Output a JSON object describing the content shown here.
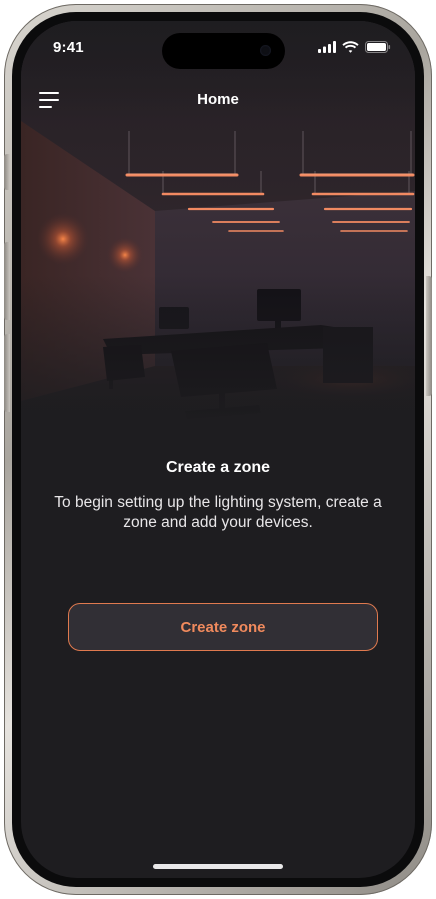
{
  "status_bar": {
    "time": "9:41",
    "icons": [
      "cellular-signal-icon",
      "wifi-icon",
      "battery-icon"
    ]
  },
  "nav": {
    "menu_icon": "hamburger-menu-icon",
    "title": "Home"
  },
  "hero": {
    "image": "dark office room with orange linear pendant lights and wall sconces"
  },
  "empty_state": {
    "title": "Create a zone",
    "description": "To begin setting up the lighting system, create a zone and add your devices."
  },
  "actions": {
    "create_zone_label": "Create zone"
  },
  "colors": {
    "background": "#1e1d20",
    "accent": "#f08a5d",
    "accent_border": "#e07a4f",
    "button_bg": "#312f35",
    "text": "#ffffff"
  }
}
